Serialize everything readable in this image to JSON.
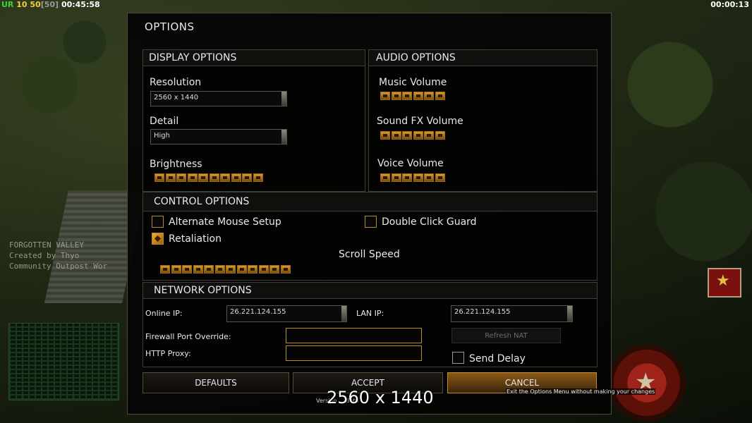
{
  "hud": {
    "left_parts": [
      "UR",
      "10",
      "50",
      "[50]",
      "00:45:58"
    ],
    "left_colors": [
      "#3cd23c",
      "#f0d040",
      "#f0d040",
      "#9a9a9a",
      "#ffffff"
    ],
    "right_time": "00:00:13"
  },
  "map_info": {
    "name": "FORGOTTEN VALLEY",
    "creator": "Created by Thyo",
    "credit": "Community Outpost Wor"
  },
  "dialog": {
    "title": "OPTIONS",
    "display": {
      "heading": "DISPLAY OPTIONS",
      "resolution_label": "Resolution",
      "resolution_value": "2560 x 1440",
      "detail_label": "Detail",
      "detail_value": "High",
      "brightness_label": "Brightness",
      "brightness_notches": 10
    },
    "audio": {
      "heading": "AUDIO OPTIONS",
      "music_label": "Music Volume",
      "sfx_label": "Sound FX Volume",
      "voice_label": "Voice Volume",
      "notches": 6
    },
    "control": {
      "heading": "CONTROL OPTIONS",
      "alt_mouse_label": "Alternate Mouse Setup",
      "alt_mouse_checked": false,
      "double_click_label": "Double Click Guard",
      "double_click_checked": false,
      "retaliation_label": "Retaliation",
      "retaliation_checked": true,
      "scroll_label": "Scroll Speed",
      "scroll_notches": 12
    },
    "network": {
      "heading": "NETWORK OPTIONS",
      "online_ip_label": "Online IP:",
      "online_ip_value": "26.221.124.155",
      "lan_ip_label": "LAN IP:",
      "lan_ip_value": "26.221.124.155",
      "firewall_label": "Firewall Port Override:",
      "firewall_value": "",
      "proxy_label": "HTTP Proxy:",
      "proxy_value": "",
      "refresh_nat_label": "Refresh NAT",
      "send_delay_label": "Send Delay",
      "send_delay_checked": false
    },
    "buttons": {
      "defaults": "DEFAULTS",
      "accept": "ACCEPT",
      "cancel": "CANCEL"
    },
    "tooltip": "Exit the Options Menu without making your changes",
    "version": "Version ... Beta ...",
    "overlay_text": "2560 x 1440"
  },
  "colors": {
    "accent": "#d89a28",
    "panel_border": "#3f3f38"
  }
}
